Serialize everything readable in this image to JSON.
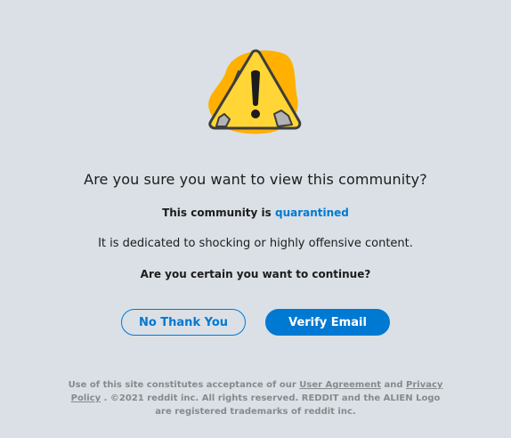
{
  "header": {
    "title": "Are you sure you want to view this community?"
  },
  "status": {
    "prefix": "This community is",
    "link_text": "quarantined"
  },
  "description": "It is dedicated to shocking or highly offensive content.",
  "question": "Are you certain you want to continue?",
  "buttons": {
    "decline_label": "No Thank You",
    "accept_label": "Verify Email"
  },
  "footer": {
    "part1": "Use of this site constitutes acceptance of our",
    "user_agreement": "User Agreement",
    "and": "and",
    "privacy_policy": "Privacy Policy",
    "period": ".",
    "part2": "©2021 reddit inc. All rights reserved. REDDIT and the ALIEN Logo are registered trademarks of reddit inc."
  },
  "colors": {
    "background": "#dae0e6",
    "accent": "#0079d3",
    "warning_yellow": "#ffd635",
    "warning_orange": "#ffb000"
  },
  "icons": {
    "warning": "warning-triangle-icon"
  }
}
